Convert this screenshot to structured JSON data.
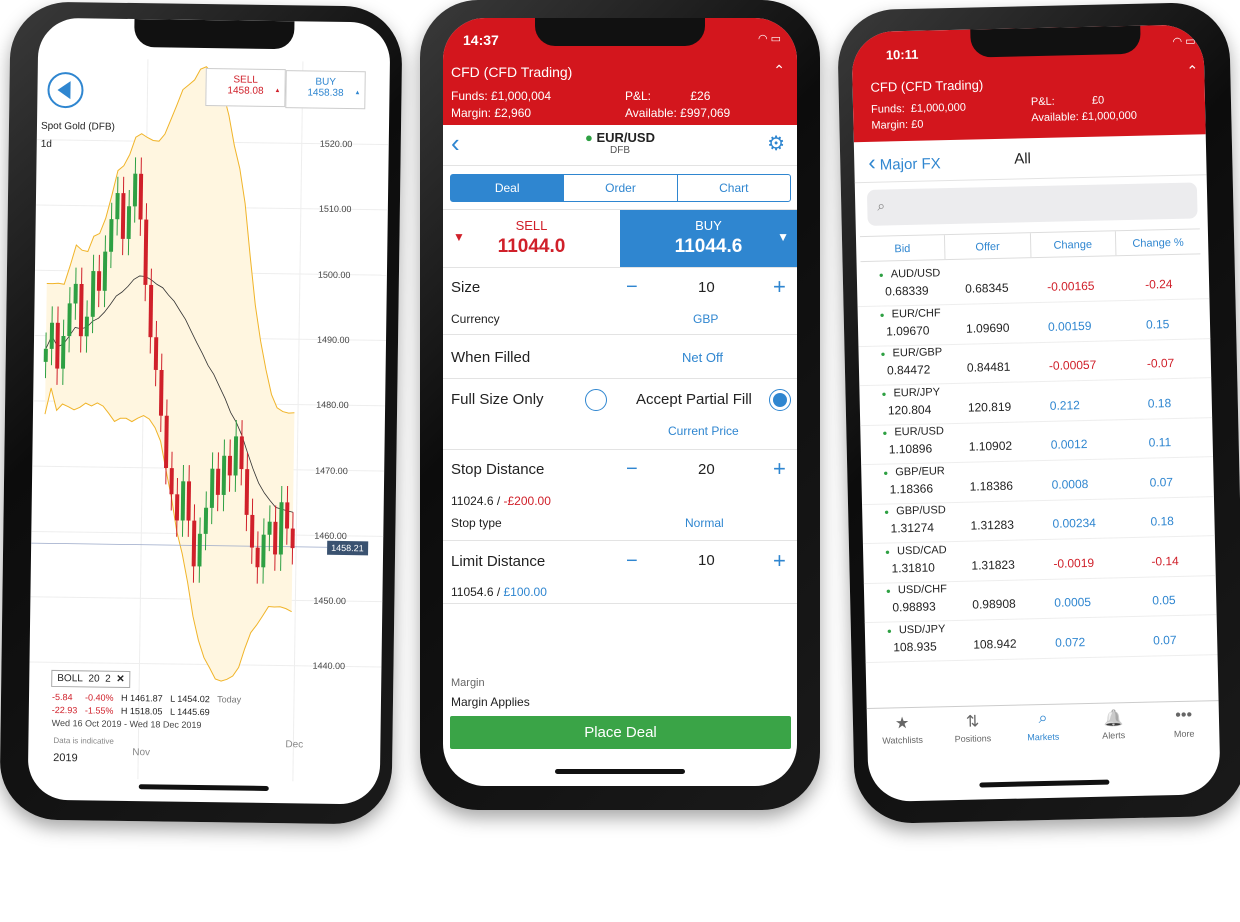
{
  "left_phone": {
    "instrument": "Spot Gold (DFB)",
    "timeframe": "1d",
    "sell": {
      "label": "SELL",
      "price": "1458.08"
    },
    "buy": {
      "label": "BUY",
      "price": "1458.38"
    },
    "current_price": "1458.21",
    "y_ticks": [
      "1520.00",
      "1510.00",
      "1500.00",
      "1490.00",
      "1480.00",
      "1470.00",
      "1460.00",
      "1450.00",
      "1440.00"
    ],
    "x_labels": {
      "nov": "Nov",
      "dec": "Dec",
      "year": "2019"
    },
    "indicator": {
      "name": "BOLL",
      "period": "20",
      "dev": "2",
      "close": "✕"
    },
    "stats": {
      "today_change": "-5.84",
      "today_pct": "-0.40%",
      "today_high": "H 1461.87",
      "today_low": "L 1454.02",
      "today_label": "Today",
      "range_change": "-22.93",
      "range_pct": "-1.55%",
      "range_high": "H 1518.05",
      "range_low": "L 1445.69",
      "range_dates": "Wed 16 Oct 2019 - Wed 18 Dec 2019"
    },
    "disclaimer": "Data is indicative",
    "colors": {
      "up": "#2ea043",
      "down": "#d0202a",
      "band": "#f0b429",
      "band_fill": "#fff6e0"
    }
  },
  "chart_data": {
    "type": "candlestick",
    "title": "Spot Gold (DFB)",
    "ylim": [
      1436,
      1525
    ],
    "closes": [
      1488,
      1492,
      1485,
      1490,
      1495,
      1498,
      1490,
      1493,
      1500,
      1497,
      1503,
      1508,
      1512,
      1505,
      1510,
      1515,
      1508,
      1498,
      1490,
      1485,
      1478,
      1470,
      1466,
      1462,
      1468,
      1462,
      1455,
      1460,
      1464,
      1470,
      1466,
      1472,
      1469,
      1475,
      1470,
      1463,
      1458,
      1455,
      1460,
      1462,
      1457,
      1465,
      1461,
      1458
    ]
  },
  "middle_phone": {
    "time": "14:37",
    "account": "CFD (CFD Trading)",
    "funds_label": "Funds:",
    "funds": "£1,000,004",
    "pnl_label": "P&L:",
    "pnl": "£26",
    "margin_label": "Margin:",
    "margin": "£2,960",
    "available_label": "Available:",
    "available": "£997,069",
    "market": "EUR/USD",
    "market_type": "DFB",
    "tabs": [
      "Deal",
      "Order",
      "Chart"
    ],
    "sell": {
      "label": "SELL",
      "price": "11044.0"
    },
    "buy": {
      "label": "BUY",
      "price": "11044.6"
    },
    "size_label": "Size",
    "size": "10",
    "currency_label": "Currency",
    "currency": "GBP",
    "when_filled_label": "When Filled",
    "when_filled": "Net Off",
    "full_size_label": "Full Size Only",
    "partial_label": "Accept Partial Fill",
    "current_price_label": "Current Price",
    "stop_label": "Stop Distance",
    "stop": "20",
    "stop_level": "11024.6 / ",
    "stop_amount": "-£200.00",
    "stop_type_label": "Stop type",
    "stop_type": "Normal",
    "limit_label": "Limit Distance",
    "limit": "10",
    "limit_level": "11054.6 / ",
    "limit_amount": "£100.00",
    "margin_section_label": "Margin",
    "margin_applies": "Margin Applies",
    "place_deal": "Place Deal",
    "minus": "−",
    "plus": "+"
  },
  "right_phone": {
    "time": "10:11",
    "account": "CFD (CFD Trading)",
    "funds_label": "Funds:",
    "funds": "£1,000,000",
    "pnl_label": "P&L:",
    "pnl": "£0",
    "margin_label": "Margin:",
    "margin": "£0",
    "available_label": "Available:",
    "available": "£1,000,000",
    "back_label": "Major FX",
    "title": "All",
    "search_placeholder": "",
    "columns": [
      "Bid",
      "Offer",
      "Change",
      "Change %"
    ],
    "rows": [
      {
        "name": "AUD/USD",
        "bid": "0.68339",
        "offer": "0.68345",
        "change": "-0.00165",
        "pct": "-0.24",
        "dir": "down"
      },
      {
        "name": "EUR/CHF",
        "bid": "1.09670",
        "offer": "1.09690",
        "change": "0.00159",
        "pct": "0.15",
        "dir": "up"
      },
      {
        "name": "EUR/GBP",
        "bid": "0.84472",
        "offer": "0.84481",
        "change": "-0.00057",
        "pct": "-0.07",
        "dir": "down"
      },
      {
        "name": "EUR/JPY",
        "bid": "120.804",
        "offer": "120.819",
        "change": "0.212",
        "pct": "0.18",
        "dir": "up"
      },
      {
        "name": "EUR/USD",
        "bid": "1.10896",
        "offer": "1.10902",
        "change": "0.0012",
        "pct": "0.11",
        "dir": "up"
      },
      {
        "name": "GBP/EUR",
        "bid": "1.18366",
        "offer": "1.18386",
        "change": "0.0008",
        "pct": "0.07",
        "dir": "up"
      },
      {
        "name": "GBP/USD",
        "bid": "1.31274",
        "offer": "1.31283",
        "change": "0.00234",
        "pct": "0.18",
        "dir": "up"
      },
      {
        "name": "USD/CAD",
        "bid": "1.31810",
        "offer": "1.31823",
        "change": "-0.0019",
        "pct": "-0.14",
        "dir": "down"
      },
      {
        "name": "USD/CHF",
        "bid": "0.98893",
        "offer": "0.98908",
        "change": "0.0005",
        "pct": "0.05",
        "dir": "up"
      },
      {
        "name": "USD/JPY",
        "bid": "108.935",
        "offer": "108.942",
        "change": "0.072",
        "pct": "0.07",
        "dir": "up"
      }
    ],
    "tabs": [
      {
        "label": "Watchlists",
        "icon": "★"
      },
      {
        "label": "Positions",
        "icon": "⇅"
      },
      {
        "label": "Markets",
        "icon": "⌕"
      },
      {
        "label": "Alerts",
        "icon": "🔔"
      },
      {
        "label": "More",
        "icon": "•••"
      }
    ],
    "active_tab": "Markets"
  }
}
